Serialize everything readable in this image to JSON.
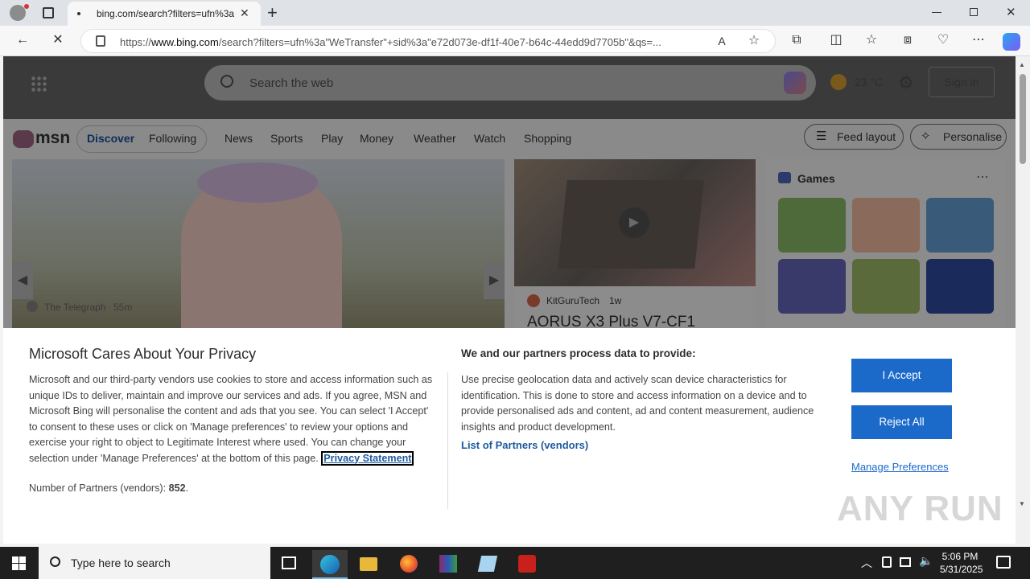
{
  "browser": {
    "tab_title": "bing.com/search?filters=ufn%3a",
    "url_prefix": "https://",
    "url_domain": "www.bing.com",
    "url_rest": "/search?filters=ufn%3a\"WeTransfer\"+sid%3a\"e72d073e-df1f-40e7-b64c-44edd9d7705b\"&qs=..."
  },
  "bing": {
    "search_placeholder": "Search the web",
    "temperature": "23 °C",
    "signin_label": "Sign in"
  },
  "msn": {
    "logo_text": "msn",
    "tabs": [
      {
        "label": "Discover"
      },
      {
        "label": "Following"
      }
    ],
    "nav": [
      {
        "label": "News"
      },
      {
        "label": "Sports"
      },
      {
        "label": "Play"
      },
      {
        "label": "Money"
      },
      {
        "label": "Weather"
      },
      {
        "label": "Watch"
      },
      {
        "label": "Shopping"
      }
    ],
    "feed_layout_label": "Feed layout",
    "personalise_label": "Personalise",
    "hero_source": "The Telegraph",
    "hero_time": "55m",
    "video_source": "KitGuruTech",
    "video_time": "1w",
    "video_title": "AORUS X3 Plus V7-CF1",
    "games_title": "Games"
  },
  "privacy": {
    "title": "Microsoft Cares About Your Privacy",
    "body": "Microsoft and our third-party vendors use cookies to store and access information such as unique IDs to deliver, maintain and improve our services and ads. If you agree, MSN and Microsoft Bing will personalise the content and ads that you see. You can select 'I Accept' to consent to these uses or click on 'Manage preferences' to review your options and exercise your right to object to Legitimate Interest where used.  You can change your selection under 'Manage Preferences' at the bottom of this page.",
    "privacy_statement_link": "Privacy Statement",
    "partners_label": "Number of Partners (vendors):",
    "partners_count": "852",
    "right_title": "We and our partners process data to provide:",
    "right_body": "Use precise geolocation data and actively scan device characteristics for identification. This is done to store and access information on a device and to provide personalised ads and content, ad and content measurement, audience insights and product development.",
    "vendors_link": "List of Partners (vendors)",
    "accept_label": "I Accept",
    "reject_label": "Reject All",
    "manage_label": "Manage Preferences"
  },
  "taskbar": {
    "search_placeholder": "Type here to search",
    "time": "5:06 PM",
    "date": "5/31/2025"
  },
  "watermark": "ANY RUN"
}
